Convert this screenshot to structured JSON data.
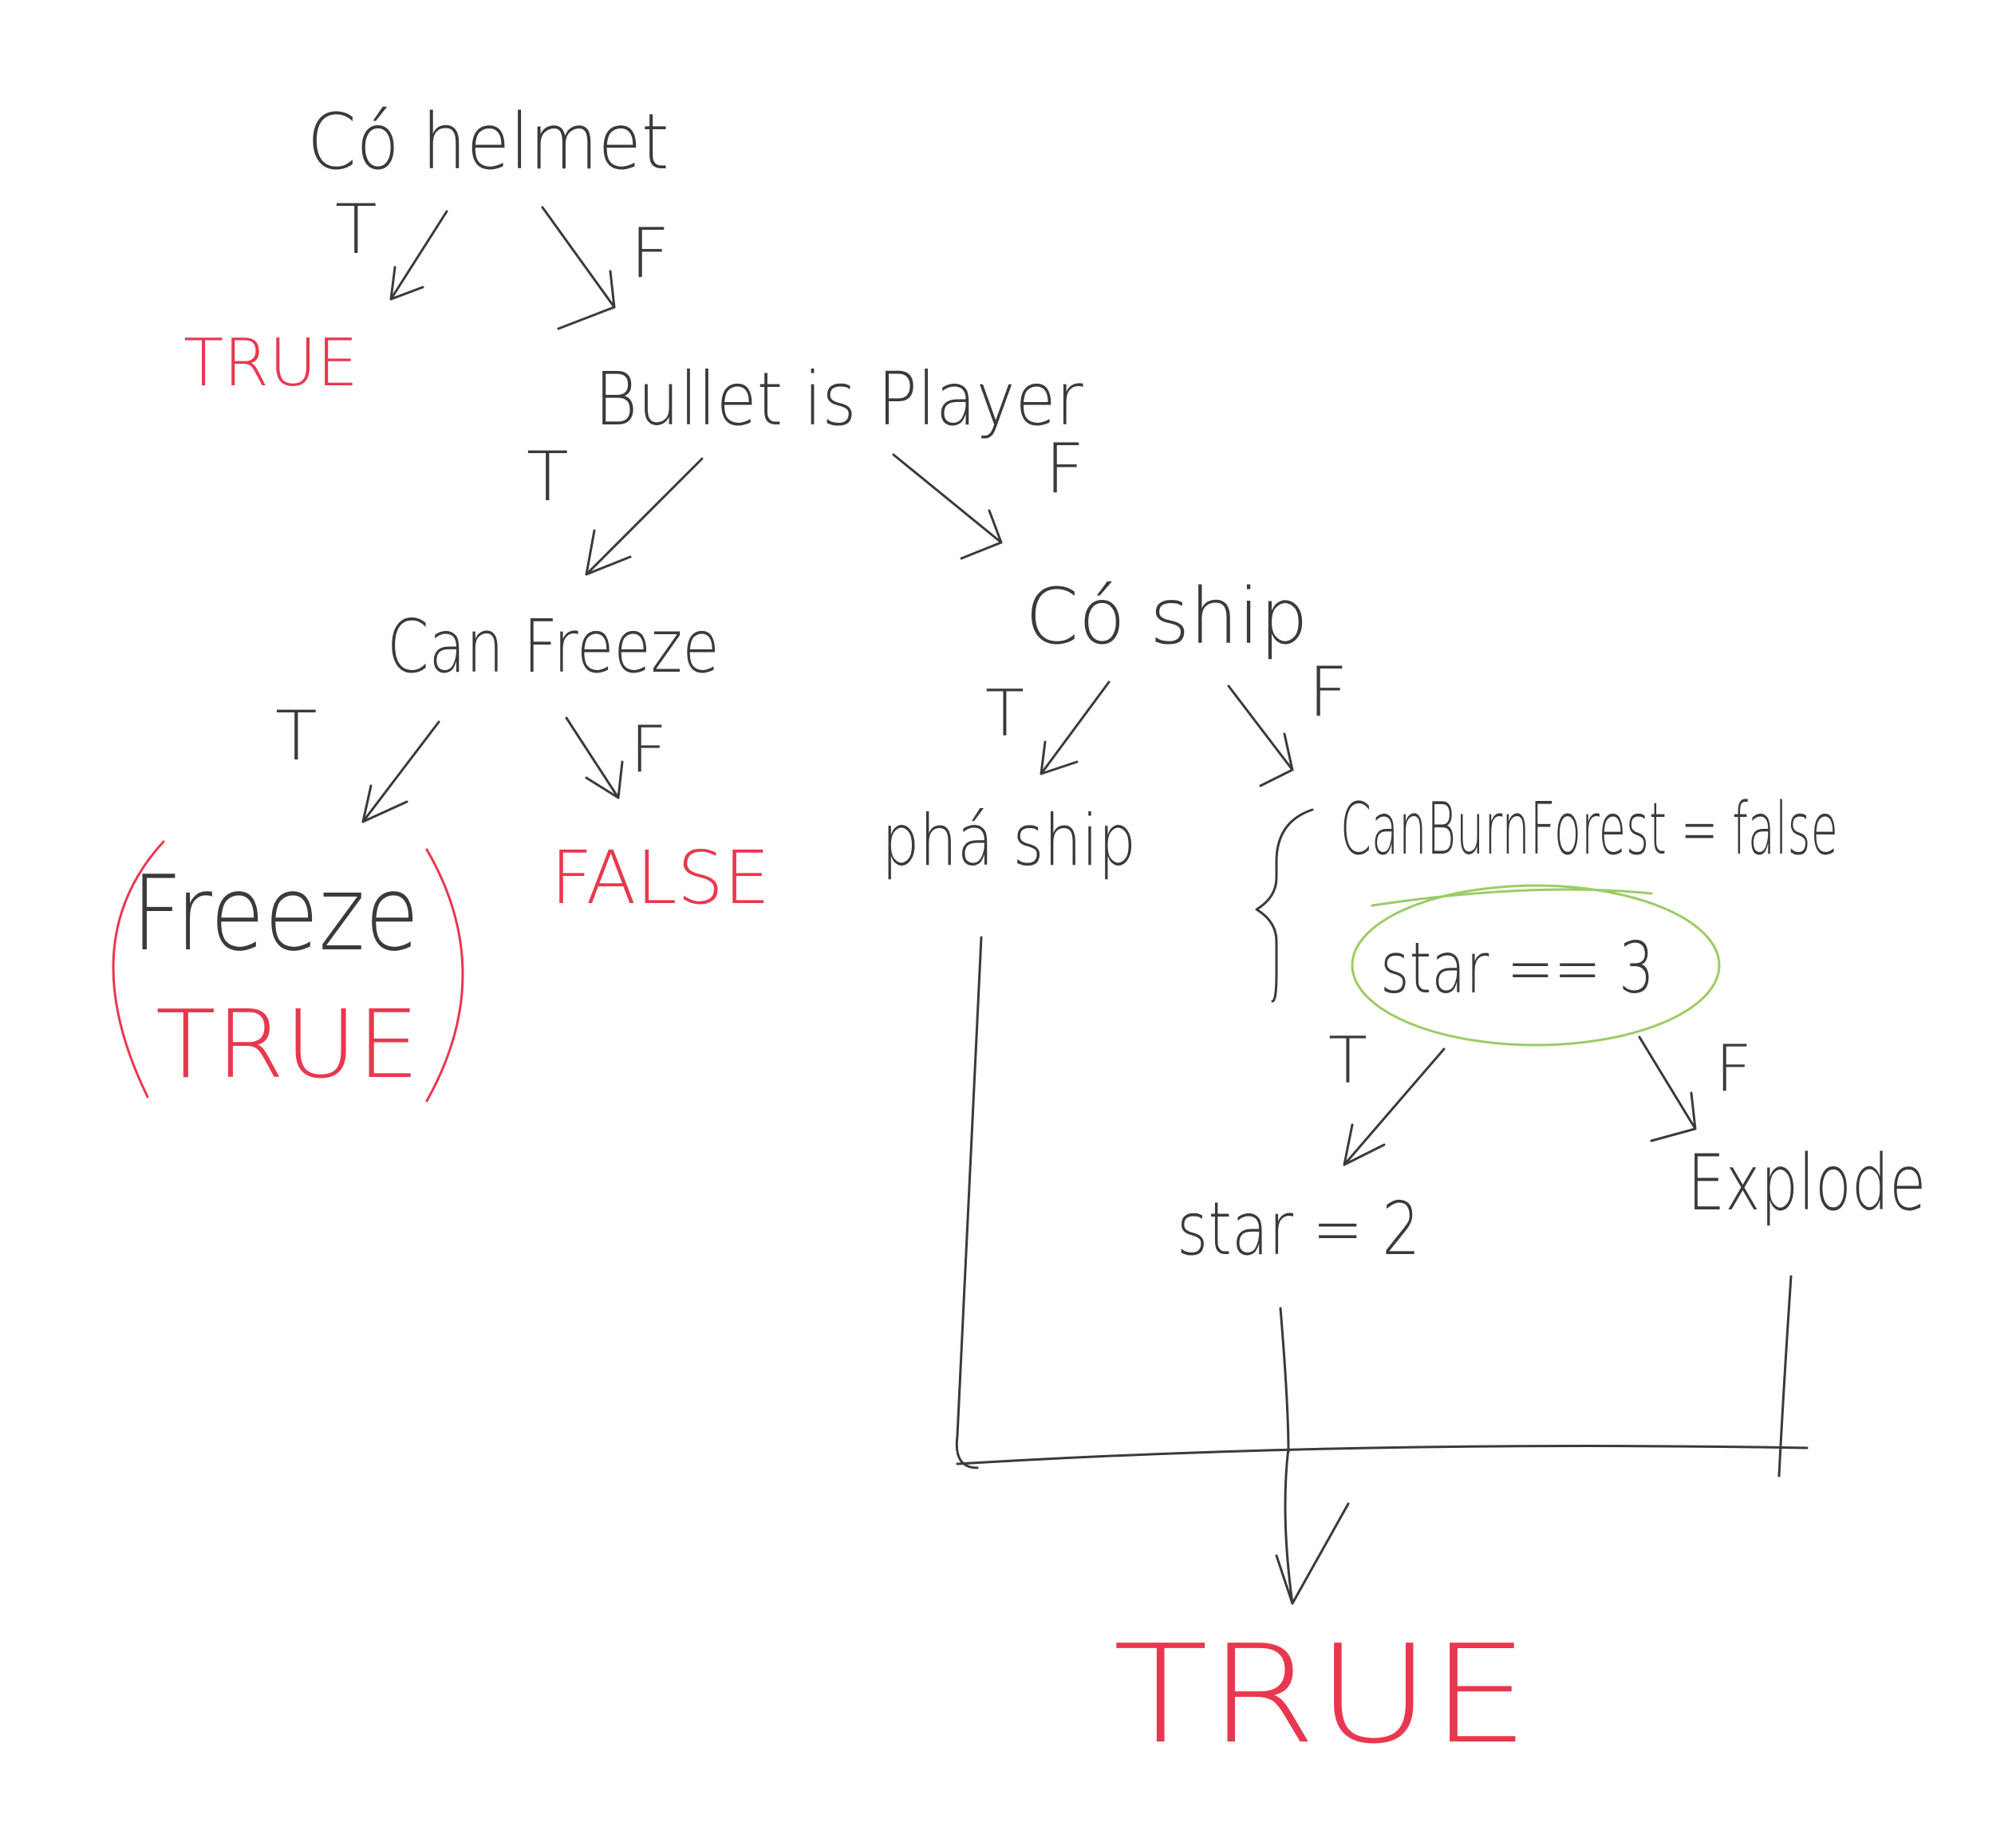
{
  "nodes": {
    "helmet": "Có helmet",
    "bullet_player": "Bullet is Player",
    "can_freeze": "Can Freeze",
    "co_ship": "Có ship",
    "pha_ship": "phá ship",
    "can_burn_forest": "CanBurnForest = false",
    "star_eq_3": "star == 3",
    "star_2": "star = 2",
    "explode": "Explode",
    "freeze": "Freeze"
  },
  "results": {
    "helmet_true": "TRUE",
    "freeze_true": "TRUE",
    "freeze_false": "FALSE",
    "final_true": "TRUE"
  },
  "branch_labels": {
    "t": "T",
    "f": "F"
  },
  "colors": {
    "ink": "#3a3a3a",
    "result": "#e8384f",
    "highlight": "#9ccc65"
  }
}
